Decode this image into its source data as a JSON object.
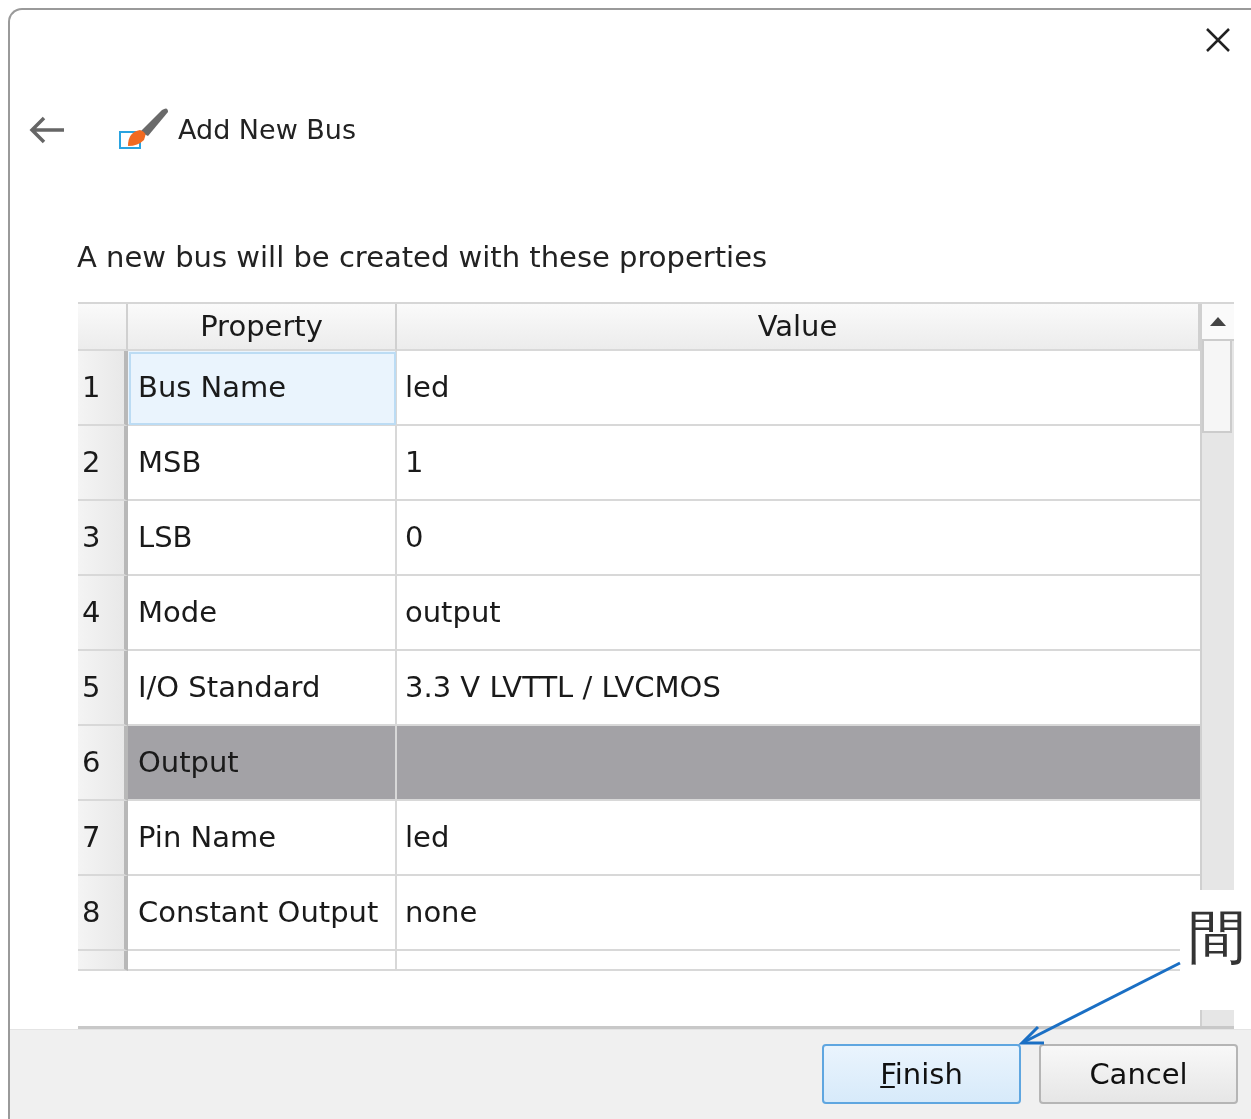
{
  "dialog": {
    "title": "Add New Bus",
    "description": "A new bus will be created with these properties"
  },
  "table": {
    "columns": [
      "Property",
      "Value"
    ],
    "rows": [
      {
        "number": "1",
        "kind": "property",
        "property": "Bus Name",
        "value": "led",
        "selected": true
      },
      {
        "number": "2",
        "kind": "property",
        "property": "MSB",
        "value": "1",
        "selected": false
      },
      {
        "number": "3",
        "kind": "property",
        "property": "LSB",
        "value": "0",
        "selected": false
      },
      {
        "number": "4",
        "kind": "property",
        "property": "Mode",
        "value": "output",
        "selected": false
      },
      {
        "number": "5",
        "kind": "property",
        "property": "I/O Standard",
        "value": "3.3 V LVTTL / LVCMOS",
        "selected": false
      },
      {
        "number": "6",
        "kind": "section",
        "property": "Output",
        "selected": false
      },
      {
        "number": "7",
        "kind": "property",
        "property": "Pin Name",
        "value": "led",
        "selected": false
      },
      {
        "number": "8",
        "kind": "property",
        "property": "Constant Output",
        "value": "none",
        "selected": false
      }
    ]
  },
  "buttons": [
    {
      "label": "Finish",
      "mnemonic": true,
      "default": true
    },
    {
      "label": "Cancel",
      "mnemonic": false,
      "default": false
    }
  ],
  "annotation": {
    "text": "間"
  }
}
